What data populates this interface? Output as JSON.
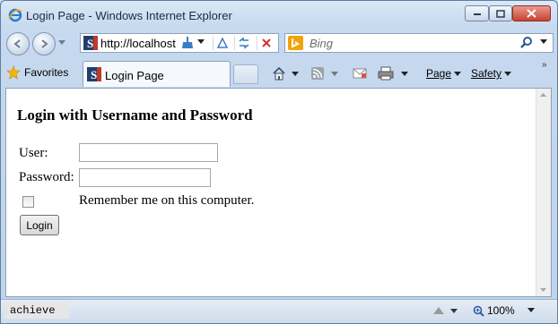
{
  "window": {
    "title": "Login Page - Windows Internet Explorer"
  },
  "address_bar": {
    "url": "http://localhost"
  },
  "search": {
    "placeholder": "Bing"
  },
  "command_bar": {
    "favorites_label": "Favorites",
    "tab_label": "Login Page",
    "page_label": "Page",
    "safety_label": "Safety"
  },
  "page": {
    "heading": "Login with Username and Password",
    "user_label": "User:",
    "password_label": "Password:",
    "user_value": "",
    "password_value": "",
    "remember_label": "Remember me on this computer.",
    "remember_checked": false,
    "login_button": "Login"
  },
  "status_bar": {
    "text": "achieve",
    "zoom": "100%"
  },
  "colors": {
    "title_bar": "#c6d9ee",
    "close_button": "#c7442f",
    "content_bg": "#ffffff"
  }
}
